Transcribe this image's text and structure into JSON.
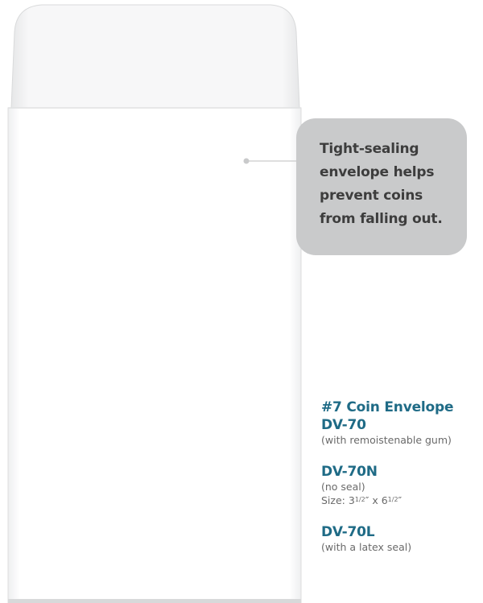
{
  "callout": {
    "text": "Tight-sealing envelope helps prevent coins from falling out."
  },
  "products": [
    {
      "title": "#7 Coin Envelope",
      "code": "DV-70",
      "note": "(with remoistenable gum)"
    },
    {
      "code": "DV-70N",
      "note": "(no seal)",
      "size_label": "Size:",
      "size_whole_1": "3",
      "size_frac_1": "1/2",
      "size_sep": "″ x ",
      "size_whole_2": "6",
      "size_frac_2": "1/2",
      "size_end": "″"
    },
    {
      "code": "DV-70L",
      "note": "(with a latex seal)"
    }
  ],
  "colors": {
    "accent": "#1f6b86",
    "callout_bg": "#c9cacb",
    "callout_text": "#3d3d3d",
    "note_text": "#6a6a6a"
  }
}
